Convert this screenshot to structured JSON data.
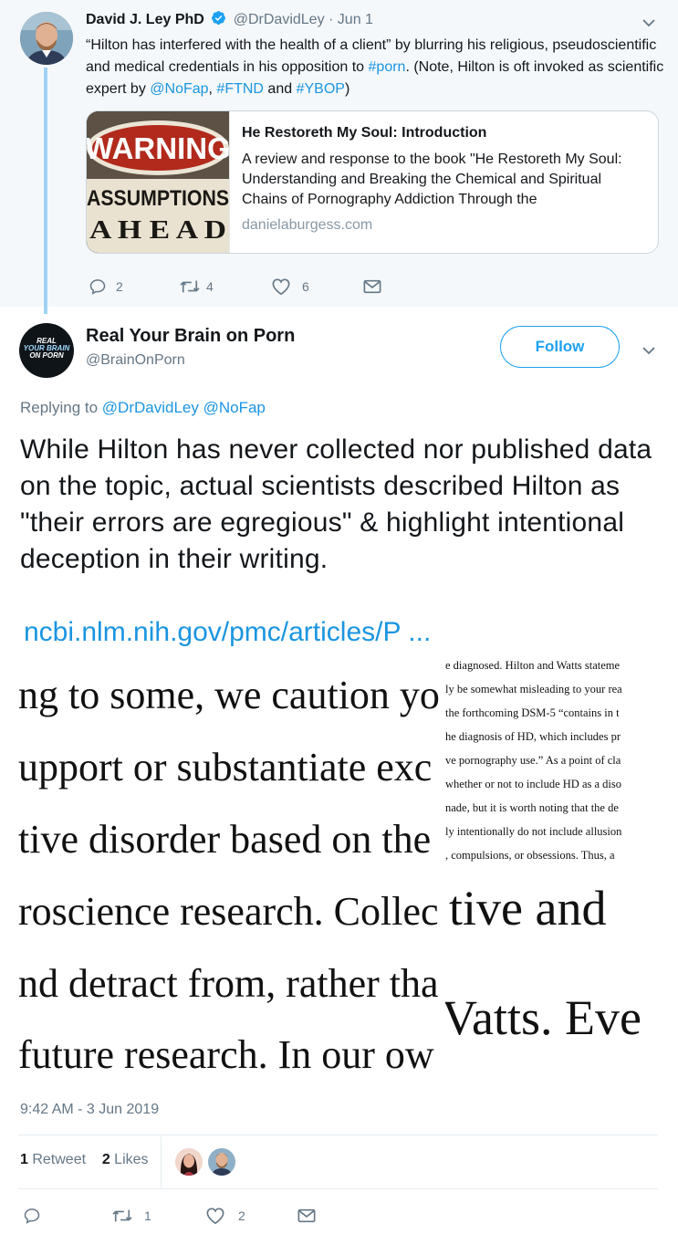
{
  "parent_tweet": {
    "name": "David J. Ley PhD",
    "handle": "@DrDavidLey",
    "dot": "·",
    "date": "Jun 1",
    "text_1": "“Hilton has interfered with the health of a client” by blurring his religious, pseudoscientific and medical credentials in his opposition to ",
    "hashtag_porn": "#porn",
    "text_2": ". (Note, Hilton is oft invoked as scientific expert by ",
    "mention_nofap": "@NoFap",
    "text_3": ", ",
    "hashtag_ftnd": "#FTND",
    "text_4": " and ",
    "hashtag_ybop": "#YBOP",
    "text_5": ")",
    "card": {
      "image_line_1": "WARNING",
      "image_line_2": "ASSUMPTIONS",
      "image_line_3": "A H E A D",
      "title": "He Restoreth My Soul: Introduction",
      "description": "A review and response to the book \"He Restoreth My Soul: Understanding and Breaking the Chemical and Spiritual Chains of Pornography Addiction Through the",
      "domain": "danielaburgess.com"
    },
    "actions": {
      "replies": "2",
      "retweets": "4",
      "likes": "6"
    }
  },
  "main_tweet": {
    "name": "Real Your Brain on Porn",
    "handle": "@BrainOnPorn",
    "avatar_text": [
      "REAL",
      "YOUR BRAIN",
      "ON PORN"
    ],
    "follow_label": "Follow",
    "replying_prefix": "Replying to ",
    "replying_1": "@DrDavidLey",
    "replying_2": "@NoFap",
    "body": "While Hilton has never collected nor published data on the topic, actual scientists described Hilton as \"their errors are egregious\" & highlight intentional deception in their writing.",
    "link": "ncbi.nlm.nih.gov/pmc/articles/P ...",
    "image_text": {
      "left_lines": [
        "ng to some, we caution yo",
        "upport or substantiate exc",
        "tive disorder based on the",
        "roscience research. Collec",
        "nd detract from, rather tha",
        "future research. In our ow"
      ],
      "right_top_lines": [
        "e diagnosed. Hilton and Watts stateme",
        "ly be somewhat misleading to your rea",
        "the forthcoming DSM-5 “contains in t",
        "he diagnosis of HD, which includes pr",
        "ve pornography use.” As a point of cla",
        "whether or not to include HD as a diso",
        "nade, but it is worth noting that the de",
        "ly intentionally do not include allusion",
        ", compulsions, or obsessions. Thus, a"
      ],
      "right_bottom_lines": [
        "tive and",
        "Vatts. Eve"
      ]
    },
    "timestamp": "9:42 AM - 3 Jun 2019",
    "retweet_count": "1",
    "retweet_label": " Retweet",
    "like_count": "2",
    "like_label": " Likes",
    "actions": {
      "retweets": "1",
      "likes": "2"
    }
  },
  "colors": {
    "link_blue": "#1b95e0",
    "follow_blue": "#1da1f2",
    "muted": "#657786",
    "thread_line": "#9fd2f4"
  }
}
